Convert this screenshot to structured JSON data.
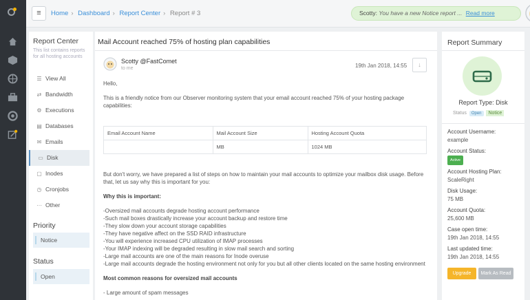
{
  "header": {
    "menu_icon": "hamburger-icon",
    "breadcrumb": [
      "Home",
      "Dashboard",
      "Report Center",
      "Report # 3"
    ],
    "notice_sender": "Scotty:",
    "notice_message": "You have a new Notice report ...",
    "notice_link": "Read more"
  },
  "left": {
    "title": "Report Center",
    "description": "This list contains reports for all hosting accounts",
    "nav": [
      {
        "label": "View All",
        "icon": "list-icon"
      },
      {
        "label": "Bandwidth",
        "icon": "bandwidth-icon"
      },
      {
        "label": "Executions",
        "icon": "executions-icon"
      },
      {
        "label": "Databases",
        "icon": "database-icon"
      },
      {
        "label": "Emails",
        "icon": "email-icon"
      },
      {
        "label": "Disk",
        "icon": "disk-icon"
      },
      {
        "label": "Inodes",
        "icon": "inodes-icon"
      },
      {
        "label": "Cronjobs",
        "icon": "cron-icon"
      },
      {
        "label": "Other",
        "icon": "more-icon"
      }
    ],
    "priority_title": "Priority",
    "priority_value": "Notice",
    "status_title": "Status",
    "status_value": "Open"
  },
  "main": {
    "title": "Mail Account reached 75% of hosting plan capabilities",
    "sender": "Scotty @FastComet",
    "to": "to me",
    "date": "19th Jan 2018, 14:55",
    "greeting": "Hello,",
    "intro": "This is a friendly notice from our Observer monitoring system that your email account reached 75% of your hosting package capabilities:",
    "table": {
      "headers": [
        "Email Account Name",
        "Mail Account Size",
        "Hosting Account Quota"
      ],
      "row": [
        "",
        "MB",
        "1024 MB"
      ]
    },
    "para2": "But don't worry, we have prepared a list of steps on how to maintain your mail accounts to optimize your mailbox disk usage. Before that, let us say why this is important for you:",
    "why_title": "Why this is important:",
    "why_items": [
      "-Oversized mail accounts degrade hosting account performance",
      "-Such mail boxes drastically increase your account backup and restore time",
      "-They slow down your account storage capabilities",
      "-They have negative affect on the SSD RAID infrastructure",
      "-You will experience increased CPU utilization of IMAP processes",
      "-Your IMAP indexing will be degraded resulting in slow mail search and sorting",
      "-Large mail accounts are one of the main reasons for Inode overuse",
      "-Large mail accounts degrade the hosting environment not only for you but all other clients located on the same hosting environment"
    ],
    "reasons_title": "Most common reasons for oversized mail accounts",
    "reasons_first": "- Large amount of spam messages"
  },
  "right": {
    "title": "Report Summary",
    "type": "Report Type: Disk",
    "status_label": "Status",
    "status_tag": "Open",
    "priority_tag": "Notice",
    "fields": [
      {
        "label": "Account Username:",
        "value": "example"
      },
      {
        "label": "Account Status:",
        "value": "Active"
      },
      {
        "label": "Account Hosting Plan:",
        "value": "ScaleRight"
      },
      {
        "label": "Disk Usage:",
        "value": "75 MB"
      },
      {
        "label": "Account Quota:",
        "value": "25,600 MB"
      },
      {
        "label": "Case open time:",
        "value": "19th Jan 2018, 14:55"
      },
      {
        "label": "Last updated time:",
        "value": "19th Jan 2018, 14:55"
      }
    ],
    "upgrade_label": "Upgrade",
    "read_label": "Mark As Read"
  },
  "colors": {
    "accent": "#3a8fd9",
    "upgrade": "#f5b52a",
    "notice_bg": "#dff3d6",
    "sidebar": "#2f3338"
  }
}
